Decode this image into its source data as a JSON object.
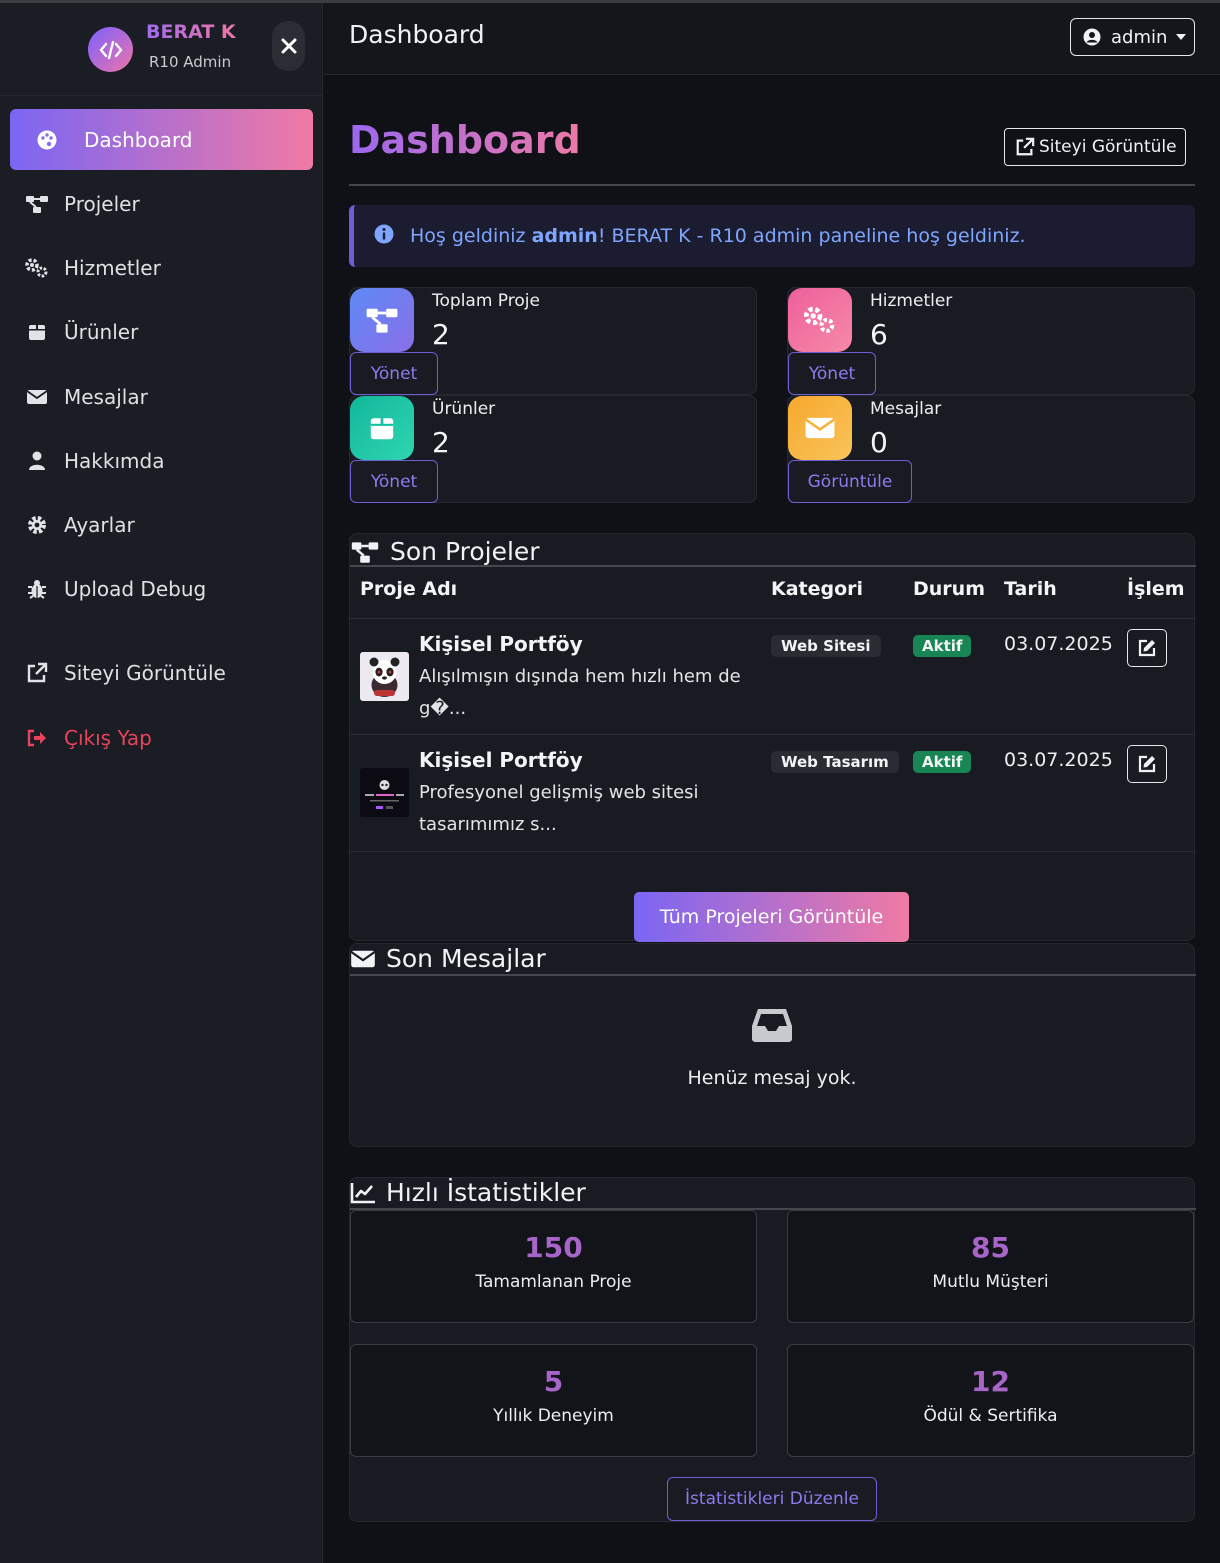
{
  "sidebar": {
    "brand_title": "BERAT K",
    "brand_subtitle": "R10 Admin",
    "items": [
      {
        "label": "Dashboard",
        "icon": "palette-icon"
      },
      {
        "label": "Projeler",
        "icon": "project-diagram-icon"
      },
      {
        "label": "Hizmetler",
        "icon": "cogs-icon"
      },
      {
        "label": "Ürünler",
        "icon": "box-icon"
      },
      {
        "label": "Mesajlar",
        "icon": "envelope-icon"
      },
      {
        "label": "Hakkımda",
        "icon": "user-icon"
      },
      {
        "label": "Ayarlar",
        "icon": "gear-icon"
      },
      {
        "label": "Upload Debug",
        "icon": "bug-icon"
      },
      {
        "label": "Siteyi Görüntüle",
        "icon": "external-link-icon"
      },
      {
        "label": "Çıkış Yap",
        "icon": "sign-out-icon"
      }
    ]
  },
  "header": {
    "title": "Dashboard",
    "user_label": "admin"
  },
  "main": {
    "page_title": "Dashboard",
    "view_site_label": "Siteyi Görüntüle",
    "alert": {
      "prefix": "Hoş geldiniz ",
      "user": "admin",
      "suffix": "! BERAT K - R10 admin paneline hoş geldiniz."
    },
    "stats": [
      {
        "label": "Toplam Proje",
        "value": "2",
        "button": "Yönet",
        "color": "#6a7cf0"
      },
      {
        "label": "Hizmetler",
        "value": "6",
        "button": "Yönet",
        "color": "#f0679a"
      },
      {
        "label": "Ürünler",
        "value": "2",
        "button": "Yönet",
        "color": "#16c1a4"
      },
      {
        "label": "Mesajlar",
        "value": "0",
        "button": "Görüntüle",
        "color": "#f7b23c"
      }
    ],
    "projects": {
      "title": "Son Projeler",
      "columns": [
        "Proje Adı",
        "Kategori",
        "Durum",
        "Tarih",
        "İşlem"
      ],
      "rows": [
        {
          "name": "Kişisel Portföy",
          "desc": "Alışılmışın dışında hem hızlı hem de g�...",
          "category": "Web Sitesi",
          "status": "Aktif",
          "date": "03.07.2025"
        },
        {
          "name": "Kişisel Portföy",
          "desc": "Profesyonel gelişmiş web sitesi tasarımımız s...",
          "category": "Web Tasarım",
          "status": "Aktif",
          "date": "03.07.2025"
        }
      ],
      "view_all_label": "Tüm Projeleri Görüntüle"
    },
    "messages": {
      "title": "Son Mesajlar",
      "empty_text": "Henüz mesaj yok."
    },
    "quick_stats": {
      "title": "Hızlı İstatistikler",
      "items": [
        {
          "value": "150",
          "label": "Tamamlanan Proje"
        },
        {
          "value": "85",
          "label": "Mutlu Müşteri"
        },
        {
          "value": "5",
          "label": "Yıllık Deneyim"
        },
        {
          "value": "12",
          "label": "Ödül & Sertifika"
        }
      ],
      "edit_label": "İstatistikleri Düzenle"
    }
  },
  "colors": {
    "accent_start": "#7a66f3",
    "accent_end": "#f07aa4",
    "logout": "#e8435a",
    "status_active": "#188654",
    "stat_value": "#a865c9"
  }
}
